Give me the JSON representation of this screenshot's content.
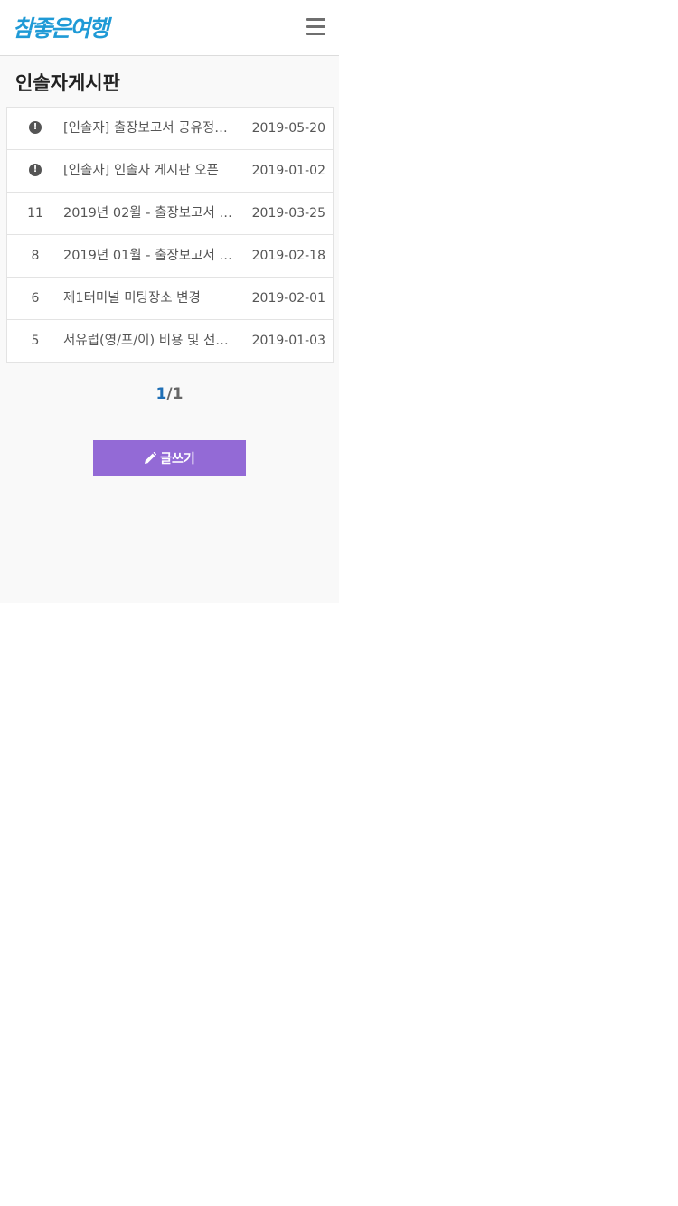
{
  "header": {
    "logo_text": "참좋은여행",
    "menu_icon": "hamburger-icon"
  },
  "page": {
    "title": "인솔자게시판"
  },
  "board": {
    "rows": [
      {
        "num": "",
        "notice": true,
        "subject": "[인솔자] 출장보고서 공유정…",
        "date": "2019-05-20"
      },
      {
        "num": "",
        "notice": true,
        "subject": "[인솔자] 인솔자 게시판 오픈",
        "date": "2019-01-02"
      },
      {
        "num": "11",
        "notice": false,
        "subject": "2019년 02월 - 출장보고서 …",
        "date": "2019-03-25"
      },
      {
        "num": "8",
        "notice": false,
        "subject": "2019년 01월 - 출장보고서 …",
        "date": "2019-02-18"
      },
      {
        "num": "6",
        "notice": false,
        "subject": "제1터미널 미팅장소 변경",
        "date": "2019-02-01"
      },
      {
        "num": "5",
        "notice": false,
        "subject": "서유럽(영/프/이) 비용 및 선…",
        "date": "2019-01-03"
      }
    ]
  },
  "pager": {
    "current": "1",
    "separator": "/",
    "total": "1"
  },
  "write_button": {
    "label": "글쓰기",
    "icon": "pencil-icon"
  },
  "colors": {
    "logo": "#1f9ad6",
    "pager_current": "#1f6fb5",
    "write_button": "#936ad6"
  }
}
